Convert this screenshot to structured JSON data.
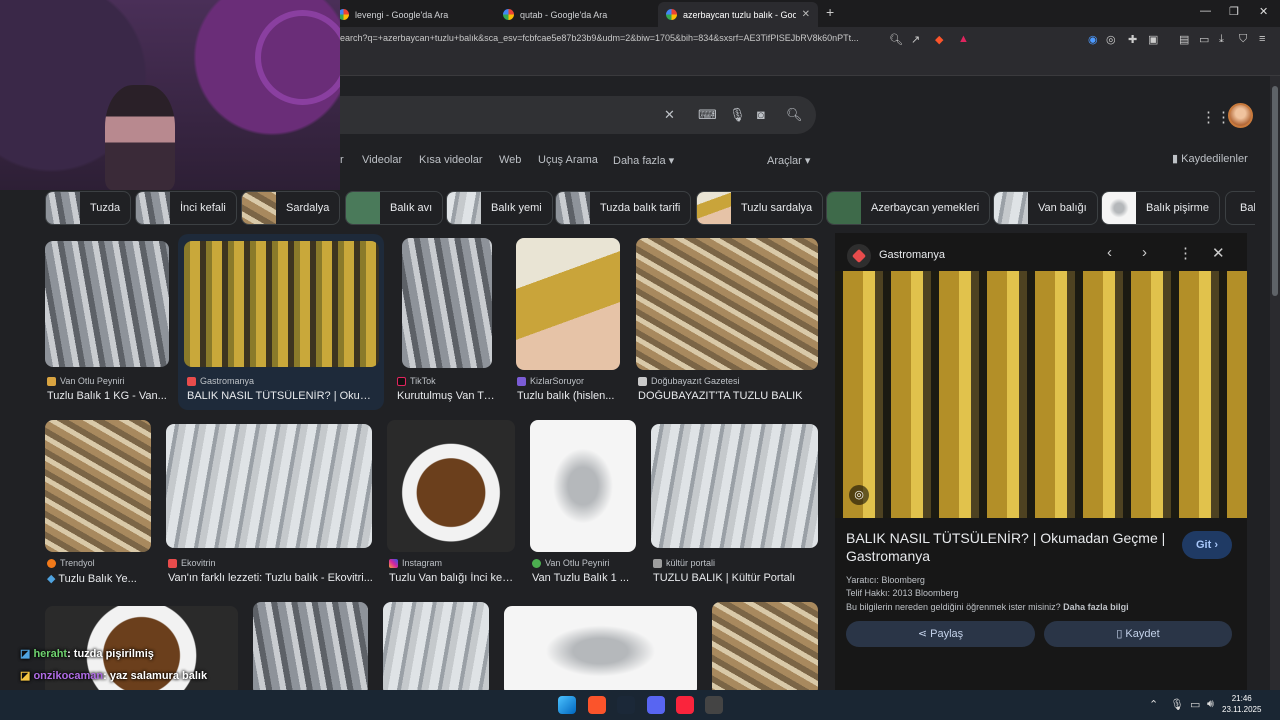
{
  "browser": {
    "tabs": [
      {
        "title": "levengi - Google'da Ara",
        "active": false
      },
      {
        "title": "qutab - Google'da Ara",
        "active": false
      },
      {
        "title": "azerbaycan tuzlu balık - Google'",
        "active": true
      }
    ],
    "new_tab": "+",
    "url": "earch?q=+azerbaycan+tuzlu+balık&sca_esv=fcbfcae5e87b23b9&udm=2&biw=1705&bih=834&sxsrf=AE3TifPISEJbRV8k60nPTt...",
    "window_controls": [
      "—",
      "❐",
      "✕"
    ]
  },
  "search": {
    "clear": "✕"
  },
  "nav": {
    "tabs": [
      "r",
      "Videolar",
      "Kısa videolar",
      "Web",
      "Uçuş Arama",
      "Daha fazla ▾"
    ],
    "tools": "Araçlar ▾",
    "saved": "Kaydedilenler"
  },
  "chips": [
    "Tuzda",
    "İnci kefali",
    "Sardalya",
    "Balık avı",
    "Balık yemi",
    "Tuzda balık tarifi",
    "Tuzlu sardalya",
    "Azerbaycan yemekleri",
    "Van balığı",
    "Balık pişirme",
    "Bali"
  ],
  "results": [
    {
      "source": "Van Otlu Peyniri",
      "title": "Tuzlu Balık 1 KG - Van..."
    },
    {
      "source": "Gastromanya",
      "title": "BALIK NASIL TÜTSÜLENİR? | Okum..."
    },
    {
      "source": "TikTok",
      "title": "Kurutulmuş Van Tu..."
    },
    {
      "source": "KizlarSoruyor",
      "title": "Tuzlu balık (hislen..."
    },
    {
      "source": "Doğubayazıt Gazetesi",
      "title": "DOĞUBAYAZIT'TA TUZLU BALIK"
    },
    {
      "source": "Trendyol",
      "title": "Tuzlu Balık Ye..."
    },
    {
      "source": "Ekovitrin",
      "title": "Van'ın farklı lezzeti: Tuzlu balık - Ekovitri..."
    },
    {
      "source": "Instagram",
      "title": "Tuzlu Van balığı İnci kef..."
    },
    {
      "source": "Van Otlu Peyniri",
      "title": "Van Tuzlu Balık 1 ..."
    },
    {
      "source": "kültür portali",
      "title": "TUZLU BALIK | Kültür Portalı"
    }
  ],
  "panel": {
    "site": "Gastromanya",
    "title": "BALIK NASIL TÜTSÜLENİR? | Okumadan Geçme | Gastromanya",
    "go": "Git",
    "creator": "Yaratıcı: Bloomberg",
    "copyright": "Telif Hakkı: 2013 Bloomberg",
    "info": "Bu bilgilerin nereden geldiğini öğrenmek ister misiniz?",
    "more": "Daha fazla bilgi",
    "share": "Paylaş",
    "save": "Kaydet"
  },
  "chat": [
    {
      "user": "heraht",
      "message": ": tuzda pişirilmiş"
    },
    {
      "user": "onzikocaman",
      "message": ": yaz salamura balık"
    }
  ],
  "taskbar": {
    "time": "21:46",
    "date": "23.11.2025"
  }
}
